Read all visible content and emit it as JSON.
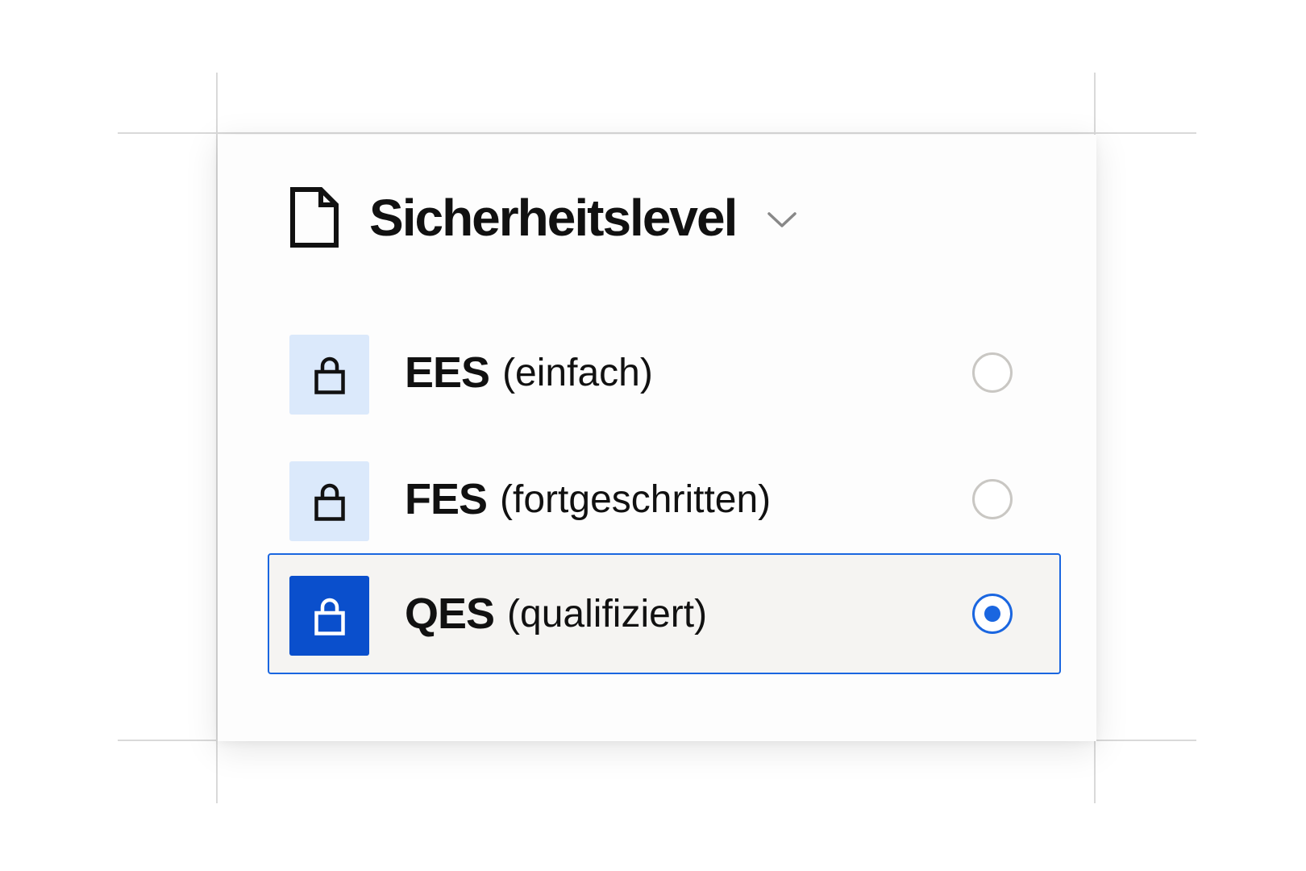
{
  "header": {
    "title": "Sicherheitslevel",
    "icon": "document-icon",
    "dropdown_icon": "chevron-down-icon"
  },
  "options": [
    {
      "code": "EES",
      "description": "(einfach)",
      "selected": false,
      "icon": "lock-icon"
    },
    {
      "code": "FES",
      "description": "(fortgeschritten)",
      "selected": false,
      "icon": "lock-icon"
    },
    {
      "code": "QES",
      "description": "(qualifiziert)",
      "selected": true,
      "icon": "lock-icon"
    }
  ],
  "colors": {
    "accent": "#1a66e0",
    "selected_icon_bg": "#0a4fcc",
    "icon_bg": "#dbe9fb",
    "selected_row_bg": "#f5f4f2",
    "radio_border": "#c9c7c3",
    "text": "#111111"
  }
}
